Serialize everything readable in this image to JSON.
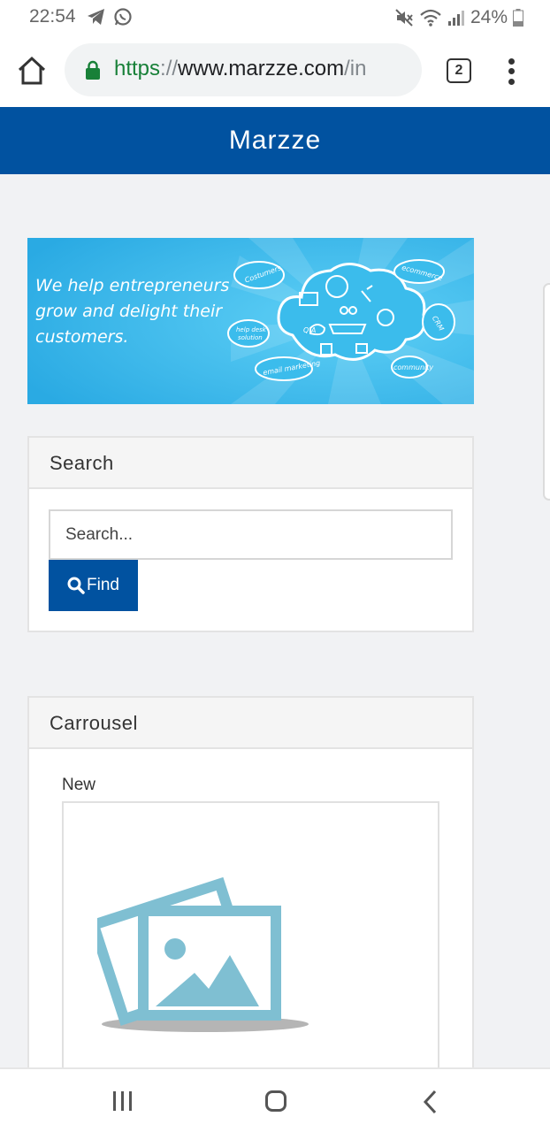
{
  "status_bar": {
    "time": "22:54",
    "battery_text": "24%",
    "left_icons": [
      "telegram-icon",
      "whatsapp-icon"
    ],
    "right_icons": [
      "mute-icon",
      "wifi-icon",
      "signal-icon",
      "battery-icon"
    ]
  },
  "browser": {
    "url_scheme": "https",
    "url_separator": "://",
    "url_host": "www.marzze.com",
    "url_path": "/in",
    "tab_count": "2"
  },
  "site": {
    "title": "Marzze",
    "brand_color": "#0152a0"
  },
  "banner": {
    "text": "We help entrepreneurs grow and delight their customers.",
    "bubbles": {
      "costumers": "Costumers",
      "ecommerce": "ecommerce",
      "help_desk": "help desk solution",
      "email_marketing": "email marketing",
      "community": "community",
      "crm": "CRM",
      "qa": "Q A"
    }
  },
  "search": {
    "heading": "Search",
    "placeholder": "Search...",
    "button_label": "Find"
  },
  "carousel": {
    "heading": "Carrousel",
    "item_label": "New"
  },
  "colors": {
    "accent": "#0152a0",
    "page_bg": "#f1f2f4",
    "banner_blue": "#34b6ea",
    "placeholder_icon": "#7fbfd2"
  }
}
